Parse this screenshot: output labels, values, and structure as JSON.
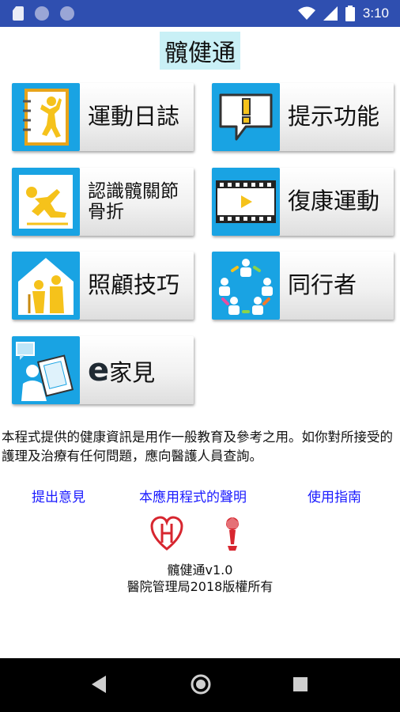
{
  "status_bar": {
    "time": "3:10"
  },
  "app": {
    "title": "髖健通"
  },
  "menu": {
    "exercise_diary": "運動日誌",
    "reminder": "提示功能",
    "knowledge_line1": "認識髖關節",
    "knowledge_line2": "骨折",
    "rehab_exercise": "復康運動",
    "care_skills": "照顧技巧",
    "peers": "同行者",
    "family_e_prefix": "e",
    "family_label": "家見"
  },
  "disclaimer": "本程式提供的健康資訊是用作一般教育及參考之用。如你對所接受的護理及治療有任何問題，應向醫護人員查詢。",
  "links": {
    "feedback": "提出意見",
    "statement": "本應用程式的聲明",
    "guide": "使用指南"
  },
  "footer": {
    "version": "髖健通v1.0",
    "copyright": "醫院管理局2018版權所有"
  },
  "colors": {
    "accent": "#19a3e3",
    "status_bar": "#2f4fb0",
    "link": "#1a1aff"
  }
}
